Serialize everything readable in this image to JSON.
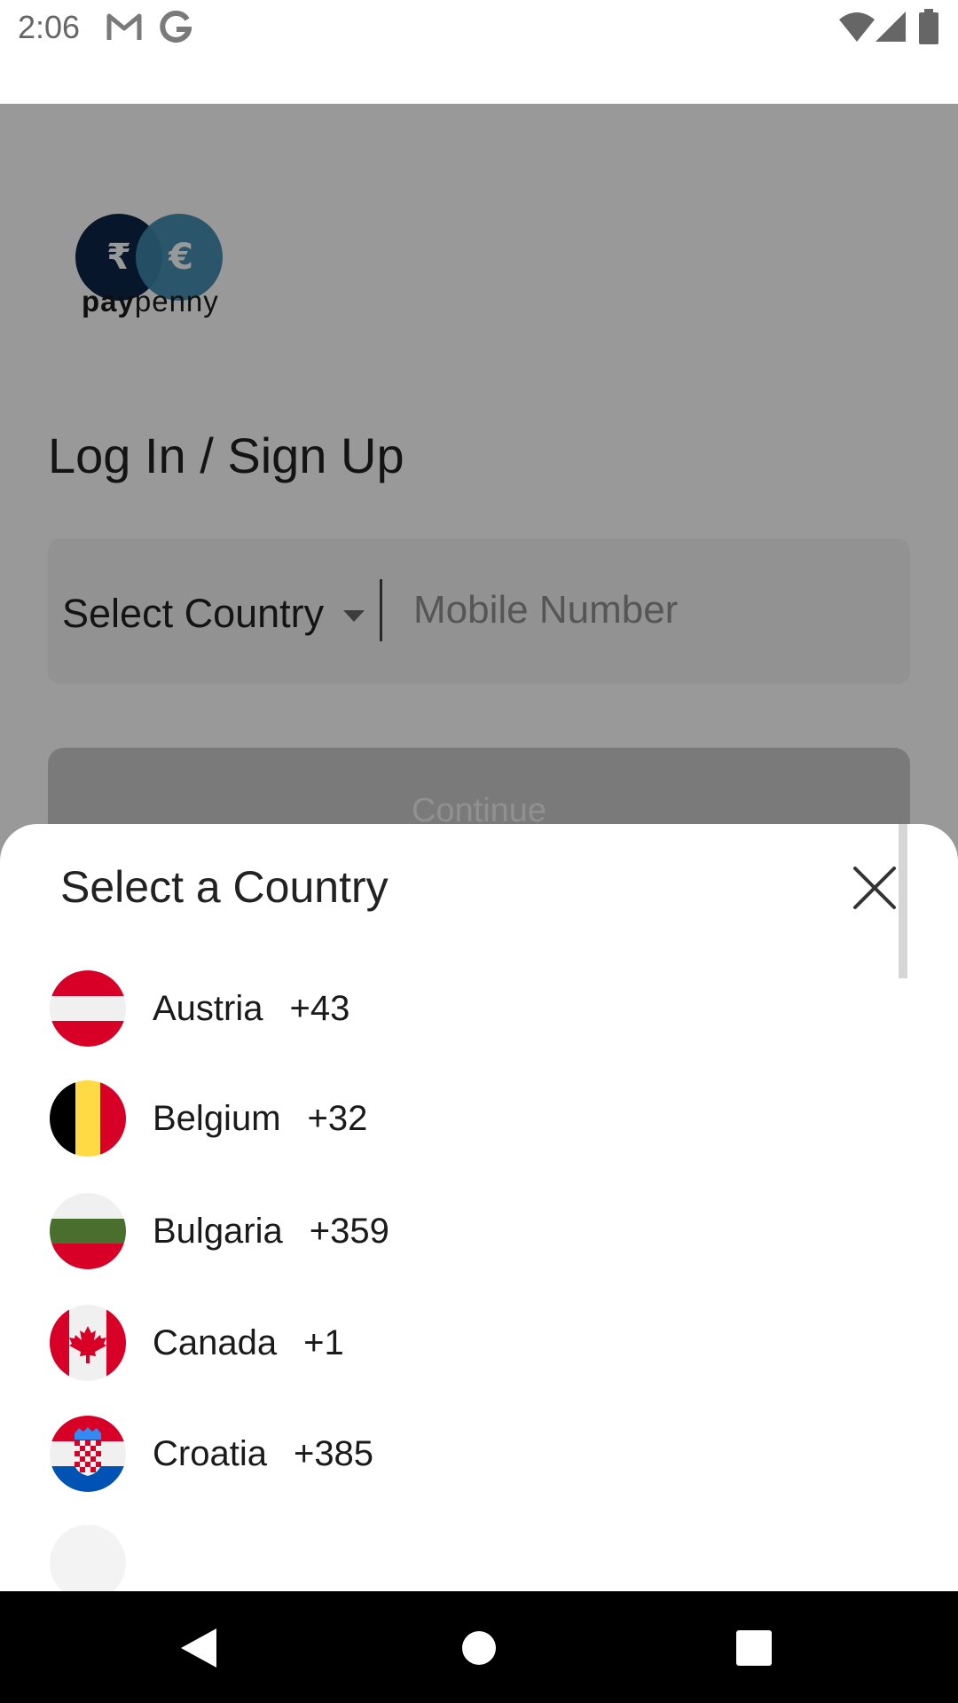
{
  "status_bar": {
    "time": "2:06",
    "notification_icons": [
      "gmail-icon",
      "google-icon"
    ],
    "system_icons": [
      "wifi-icon",
      "signal-icon",
      "battery-icon"
    ]
  },
  "logo": {
    "rupee_symbol": "₹",
    "euro_symbol": "€",
    "text_bold": "pay",
    "text_light": "penny",
    "colors": {
      "rupee_circle": "#0c2646",
      "euro_circle": "#3e88ad"
    }
  },
  "login": {
    "title": "Log In / Sign Up",
    "country_select_label": "Select Country",
    "mobile_placeholder": "Mobile Number",
    "continue_label": "Continue"
  },
  "sheet": {
    "title": "Select a Country",
    "countries": [
      {
        "name": "Austria",
        "code": "+43",
        "flag": "austria-flag"
      },
      {
        "name": "Belgium",
        "code": "+32",
        "flag": "belgium-flag"
      },
      {
        "name": "Bulgaria",
        "code": "+359",
        "flag": "bulgaria-flag"
      },
      {
        "name": "Canada",
        "code": "+1",
        "flag": "canada-flag"
      },
      {
        "name": "Croatia",
        "code": "+385",
        "flag": "croatia-flag"
      }
    ]
  },
  "nav_bar": {
    "buttons": [
      "back-icon",
      "home-icon",
      "recents-icon"
    ]
  }
}
